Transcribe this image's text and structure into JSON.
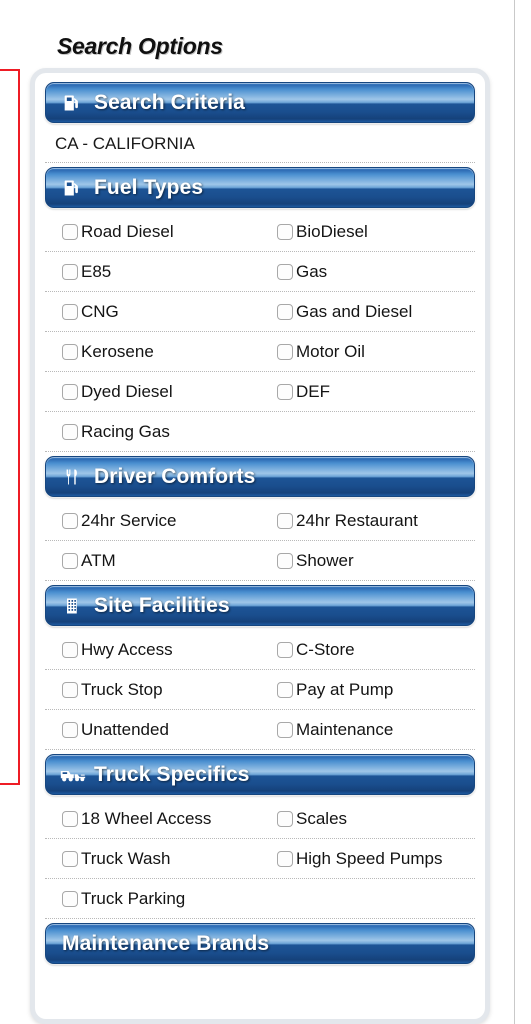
{
  "page": {
    "title": "Search Options",
    "accent_blue": "#1a4e8e",
    "highlight_red": "#ee1c25"
  },
  "sections": [
    {
      "id": "search-criteria",
      "label": "Search Criteria",
      "icon": "fuel-pump-icon",
      "value": "CA - CALIFORNIA"
    },
    {
      "id": "fuel-types",
      "label": "Fuel Types",
      "icon": "fuel-pump-icon",
      "options": [
        [
          "Road Diesel",
          "BioDiesel"
        ],
        [
          "E85",
          "Gas"
        ],
        [
          "CNG",
          "Gas and Diesel"
        ],
        [
          "Kerosene",
          "Motor Oil"
        ],
        [
          "Dyed Diesel",
          "DEF"
        ],
        [
          "Racing Gas",
          null
        ]
      ]
    },
    {
      "id": "driver-comforts",
      "label": "Driver Comforts",
      "icon": "fork-knife-icon",
      "options": [
        [
          "24hr Service",
          "24hr Restaurant"
        ],
        [
          "ATM",
          "Shower"
        ]
      ]
    },
    {
      "id": "site-facilities",
      "label": "Site Facilities",
      "icon": "building-icon",
      "options": [
        [
          "Hwy Access",
          "C-Store"
        ],
        [
          "Truck Stop",
          "Pay at Pump"
        ],
        [
          "Unattended",
          "Maintenance"
        ]
      ]
    },
    {
      "id": "truck-specifics",
      "label": "Truck Specifics",
      "icon": "truck-icon",
      "options": [
        [
          "18 Wheel Access",
          "Scales"
        ],
        [
          "Truck Wash",
          "High Speed Pumps"
        ],
        [
          "Truck Parking",
          null
        ]
      ]
    },
    {
      "id": "maintenance-brands",
      "label": "Maintenance Brands",
      "icon": null,
      "options": []
    }
  ]
}
